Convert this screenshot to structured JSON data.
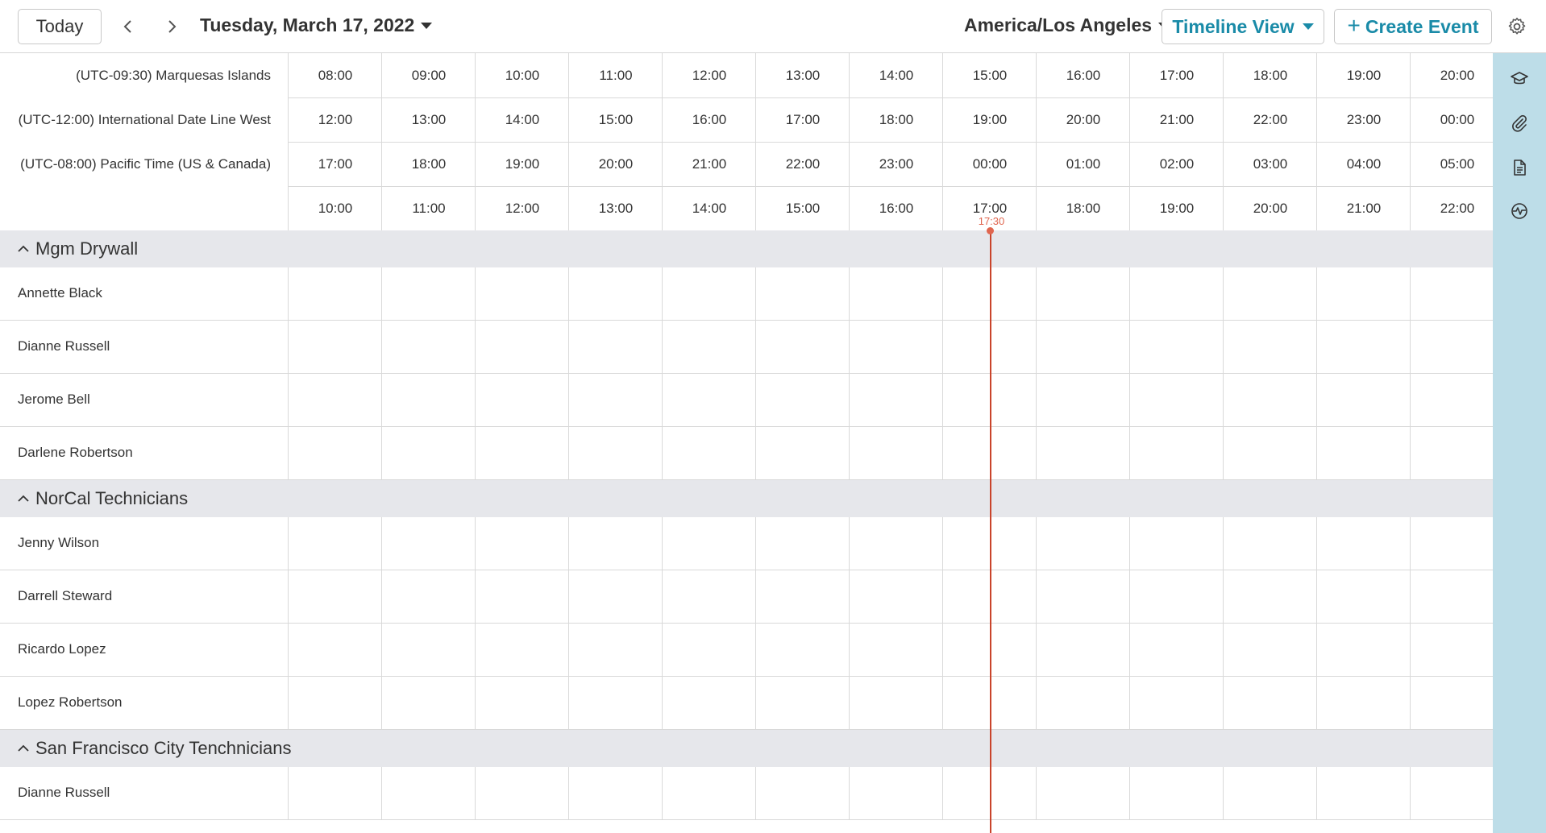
{
  "toolbar": {
    "today_label": "Today",
    "date_label": "Tuesday, March 17, 2022",
    "timezone_label": "America/Los Angeles",
    "view_label": "Timeline View",
    "create_label": "Create Event",
    "accent_color": "#1a8ba8"
  },
  "timezones": [
    {
      "label": "(UTC-09:30) Marquesas Islands",
      "hours": [
        "08:00",
        "09:00",
        "10:00",
        "11:00",
        "12:00",
        "13:00",
        "14:00",
        "15:00",
        "16:00",
        "17:00",
        "18:00",
        "19:00",
        "20:00"
      ]
    },
    {
      "label": "(UTC-12:00) International Date Line West",
      "hours": [
        "12:00",
        "13:00",
        "14:00",
        "15:00",
        "16:00",
        "17:00",
        "18:00",
        "19:00",
        "20:00",
        "21:00",
        "22:00",
        "23:00",
        "00:00"
      ]
    },
    {
      "label": "(UTC-08:00) Pacific Time (US & Canada)",
      "hours": [
        "17:00",
        "18:00",
        "19:00",
        "20:00",
        "21:00",
        "22:00",
        "23:00",
        "00:00",
        "01:00",
        "02:00",
        "03:00",
        "04:00",
        "05:00"
      ]
    },
    {
      "label": "",
      "hours": [
        "10:00",
        "11:00",
        "12:00",
        "13:00",
        "14:00",
        "15:00",
        "16:00",
        "17:00",
        "18:00",
        "19:00",
        "20:00",
        "21:00",
        "22:00"
      ]
    }
  ],
  "now_indicator": {
    "label": "17:30",
    "color": "#c9442b"
  },
  "groups": [
    {
      "name": "Mgm Drywall",
      "members": [
        "Annette Black",
        "Dianne Russell",
        "Jerome Bell",
        "Darlene Robertson"
      ]
    },
    {
      "name": "NorCal Technicians",
      "members": [
        "Jenny Wilson",
        "Darrell Steward",
        "Ricardo Lopez",
        "Lopez Robertson"
      ]
    },
    {
      "name": "San Francisco City Tenchnicians",
      "members": [
        "Dianne Russell"
      ]
    }
  ],
  "rail_icons": [
    "graduation-cap-icon",
    "paperclip-icon",
    "document-icon",
    "activity-icon"
  ]
}
